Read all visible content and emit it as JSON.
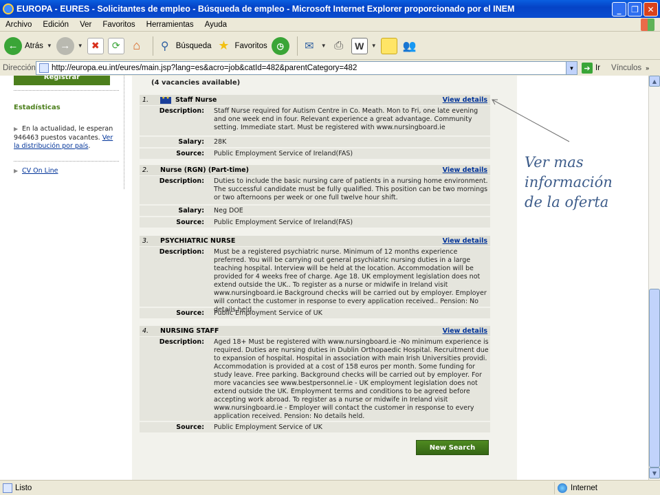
{
  "window": {
    "title": "EUROPA - EURES - Solicitantes de empleo - Búsqueda de empleo - Microsoft Internet Explorer proporcionado por el INEM"
  },
  "menu": [
    "Archivo",
    "Edición",
    "Ver",
    "Favoritos",
    "Herramientas",
    "Ayuda"
  ],
  "toolbar": {
    "back": "Atrás",
    "search": "Búsqueda",
    "favorites": "Favoritos"
  },
  "address": {
    "label": "Dirección",
    "url": "http://europa.eu.int/eures/main.jsp?lang=es&acro=job&catId=482&parentCategory=482",
    "go": "Ir",
    "links": "Vínculos"
  },
  "sidebar": {
    "register": "Registrar",
    "stats_title": "Estadísticas",
    "stats_text": "En la actualidad, le esperan 946463 puestos vacantes.",
    "stats_link": "Ver la distribución por país",
    "cv_link": "CV On Line"
  },
  "results": {
    "available": "(4 vacancies available)",
    "view_details": "View details",
    "labels": {
      "description": "Description:",
      "salary": "Salary:",
      "source": "Source:"
    },
    "jobs": [
      {
        "num": "1.",
        "title": "Staff Nurse",
        "flag": true,
        "description": "Staff Nurse required for Autism Centre in Co. Meath. Mon to Fri, one late evening and one week end in four. Relevant experience a great advantage. Community setting. Immediate start. Must be registered with www.nursingboard.ie",
        "salary": "28K",
        "source": "Public Employment Service of Ireland(FAS)"
      },
      {
        "num": "2.",
        "title": "Nurse (RGN) (Part-time)",
        "flag": false,
        "description": "Duties to include the basic nursing care of patients in a nursing home environment. The successful candidate must be fully qualified. This position can be two mornings or two afternoons per week or one full twelve hour shift.",
        "salary": "Neg DOE",
        "source": "Public Employment Service of Ireland(FAS)"
      },
      {
        "num": "3.",
        "title": "PSYCHIATRIC NURSE",
        "flag": false,
        "description": "Must be a registered psychiatric nurse. Minimum of 12 months experience preferred. You will be carrying out general psychiatric nursing duties in a large teaching hospital. Interview will be held at the location. Accommodation will be provided for 4 weeks free of charge. Age 18. UK employment legislation does not extend outside the UK.. To register as a nurse or midwife in Ireland visit www.nursingboard.ie Background checks will be carried out by employer. Employer will contact the customer in response to every application received.. Pension: No details held.",
        "salary": null,
        "source": "Public Employment Service of UK"
      },
      {
        "num": "4.",
        "title": "NURSING STAFF",
        "flag": false,
        "description": "Aged 18+ Must be registered with www.nursingboard.ie -No minimum experience is required. Duties are nursing duties in Dublin Orthopaedic Hospital. Recruitment due to expansion of hospital. Hospital in association with main Irish Universities providi. Accommodation is provided at a cost of 158 euros per month. Some funding for study leave. Free parking. Background checks will be carried out by employer. For more vacancies see www.bestpersonnel.ie - UK employment legislation does not extend outside the UK. Employment terms and conditions to be agreed before accepting work abroad. To register as a nurse or midwife in Ireland visit www.nursingboard.ie - Employer will contact the customer in response to every application received. Pension: No details held.",
        "salary": null,
        "source": "Public Employment Service of UK"
      }
    ],
    "new_search": "New Search"
  },
  "annotation": {
    "line1": "Ver mas",
    "line2": "información",
    "line3": "de la oferta"
  },
  "status": {
    "text": "Listo",
    "zone": "Internet"
  }
}
